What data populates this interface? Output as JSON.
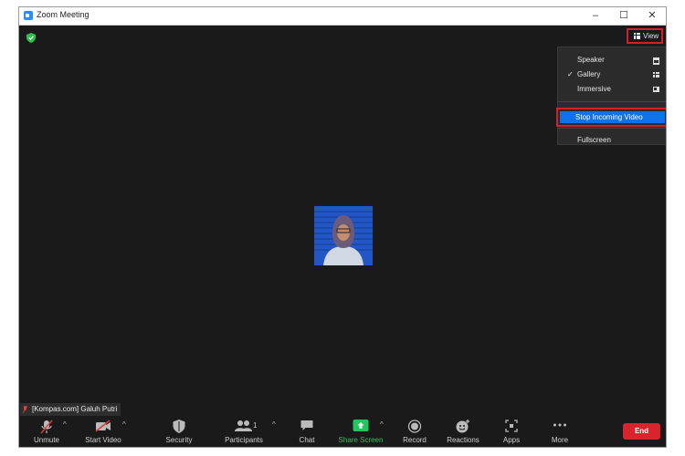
{
  "window": {
    "title": "Zoom Meeting",
    "controls": {
      "minimize": "–",
      "maximize": "☐",
      "close": "✕"
    }
  },
  "header": {
    "view_label": "View",
    "security_status_icon": "shield-check-icon"
  },
  "view_menu": {
    "items": [
      {
        "label": "Speaker",
        "checked": false,
        "icon": "speaker-view-icon"
      },
      {
        "label": "Gallery",
        "checked": true,
        "icon": "gallery-view-icon"
      },
      {
        "label": "Immersive",
        "checked": false,
        "icon": "immersive-view-icon"
      }
    ],
    "stop_incoming_video": "Stop Incoming Video",
    "fullscreen": "Fullscreen",
    "check_mark": "✓"
  },
  "participant": {
    "name": "[Kompas.com] Galuh Putri",
    "muted": true
  },
  "toolbar": {
    "unmute": "Unmute",
    "start_video": "Start Video",
    "security": "Security",
    "participants": "Participants",
    "participants_count": "1",
    "chat": "Chat",
    "share_screen": "Share Screen",
    "record": "Record",
    "reactions": "Reactions",
    "apps": "Apps",
    "more": "More",
    "end": "End",
    "caret": "^"
  },
  "colors": {
    "accent_blue": "#0e72ed",
    "share_green": "#22c55e",
    "end_red": "#d9232d",
    "highlight_red": "#d41f28",
    "meeting_bg": "#1a1a1a"
  }
}
